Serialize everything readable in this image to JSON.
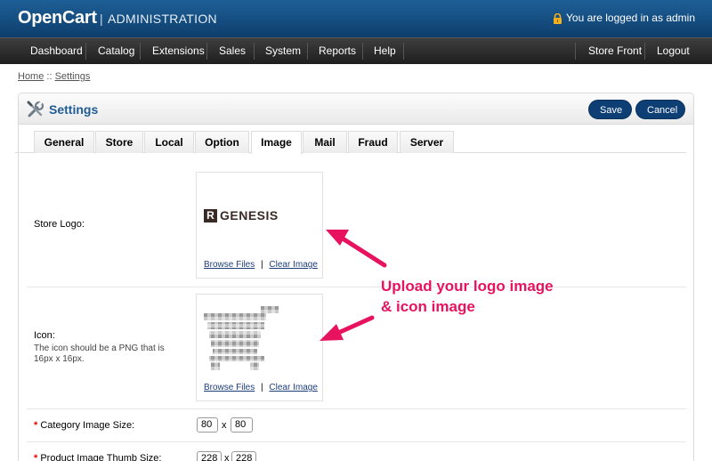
{
  "header": {
    "brand": "OpenCart",
    "separator": "|",
    "subtitle": "ADMINISTRATION",
    "logged_in": "You are logged in as admin",
    "lock_icon": "lock-icon"
  },
  "menu": {
    "items": [
      "Dashboard",
      "Catalog",
      "Extensions",
      "Sales",
      "System",
      "Reports",
      "Help"
    ],
    "right_items": [
      "Store Front",
      "Logout"
    ]
  },
  "breadcrumb": {
    "home": "Home",
    "separator": "::",
    "current": "Settings"
  },
  "panel": {
    "title": "Settings",
    "icon": "settings-icon",
    "save": "Save",
    "cancel": "Cancel"
  },
  "tabs": [
    "General",
    "Store",
    "Local",
    "Option",
    "Image",
    "Mail",
    "Fraud",
    "Server"
  ],
  "active_tab": "Image",
  "form": {
    "store_logo": {
      "label": "Store Logo:",
      "logo_text": "GENESIS",
      "logo_mark": "R",
      "browse": "Browse Files",
      "divider": "|",
      "clear": "Clear Image"
    },
    "icon": {
      "label": "Icon:",
      "help": "The icon should be a PNG that is 16px x 16px.",
      "image": "shopping-cart-icon",
      "browse": "Browse Files",
      "divider": "|",
      "clear": "Clear Image"
    },
    "category_image_size": {
      "required": "*",
      "label": "Category Image Size:",
      "width": "80",
      "x": "x",
      "height": "80"
    },
    "product_thumb_size": {
      "required": "*",
      "label": "Product Image Thumb Size:",
      "width": "228",
      "x": "x",
      "height": "228"
    }
  },
  "annotation": {
    "line1": "Upload your logo image",
    "line2": "& icon image",
    "color": "#e8135f"
  },
  "colors": {
    "header": "#1e5f97",
    "menu": "#2a2a2a",
    "button": "#0d3f75",
    "title": "#1e5c93"
  }
}
